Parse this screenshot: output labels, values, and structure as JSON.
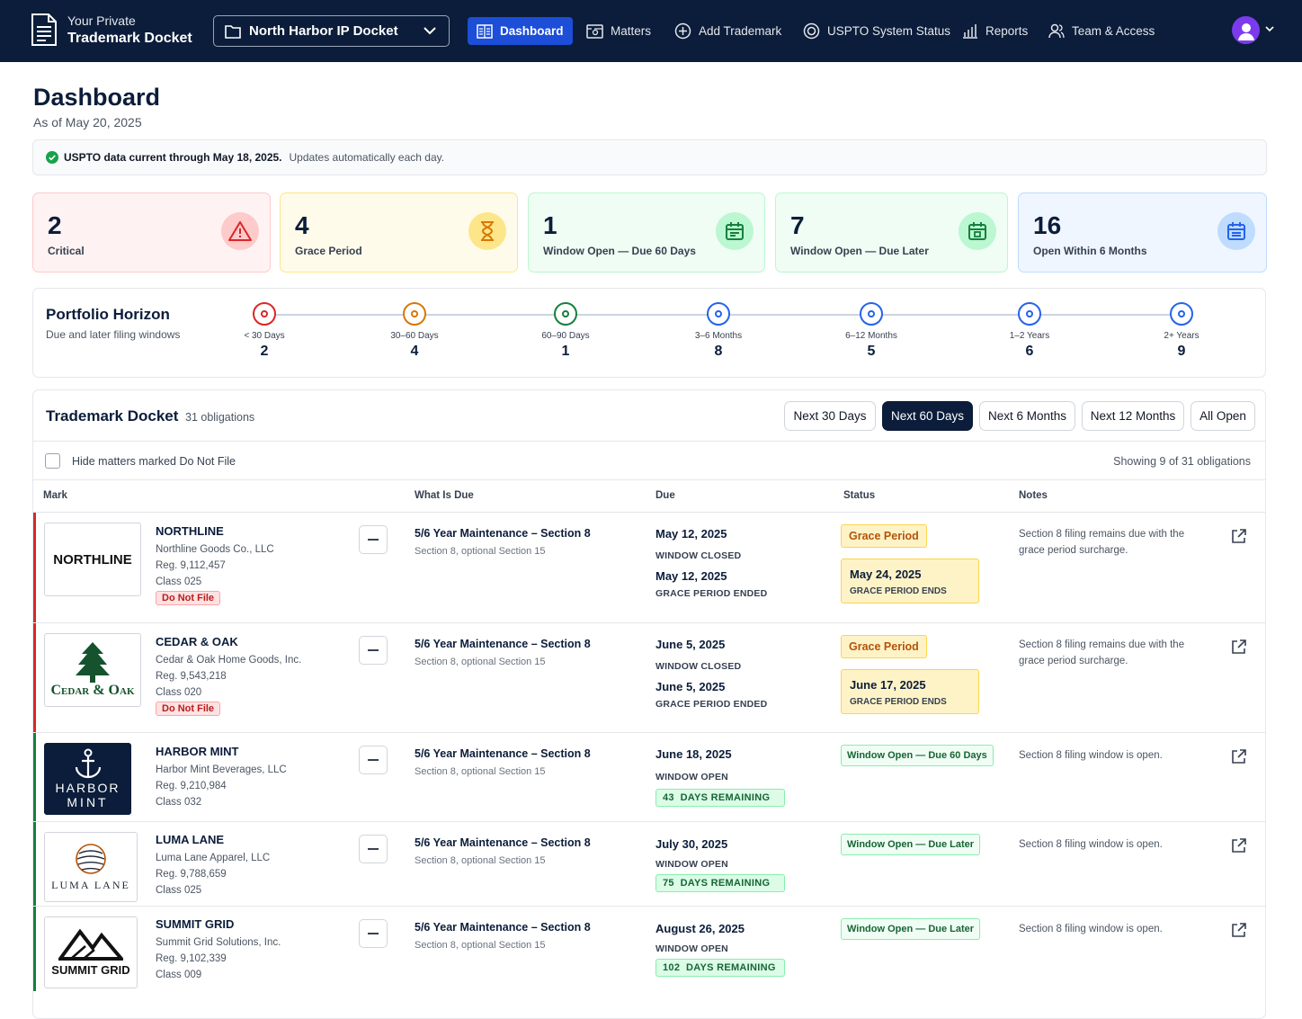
{
  "header": {
    "brand_line1": "Your Private",
    "brand_line2": "Trademark Docket",
    "docket": "North Harbor IP Docket",
    "nav": [
      {
        "label": "Dashboard",
        "icon": "dashboard-icon",
        "active": true
      },
      {
        "label": "Matters",
        "icon": "matters-icon"
      },
      {
        "label": "Add Trademark",
        "icon": "plus-circle-icon"
      },
      {
        "label": "USPTO System Status",
        "icon": "status-icon"
      },
      {
        "label": "Reports",
        "icon": "bar-chart-icon"
      },
      {
        "label": "Team & Access",
        "icon": "users-icon"
      }
    ]
  },
  "page": {
    "title": "Dashboard",
    "as_of": "As of May 20, 2025",
    "notice_bold": "USPTO data current through May 18, 2025.",
    "notice_text": "Updates automatically each day."
  },
  "cards": [
    {
      "value": "2",
      "label": "Critical",
      "icon": "alert-triangle-icon",
      "color": "#dc2626"
    },
    {
      "value": "4",
      "label": "Grace Period",
      "icon": "hourglass-icon",
      "color": "#d97706"
    },
    {
      "value": "1",
      "label": "Window Open — Due 60 Days",
      "icon": "calendar-icon",
      "color": "#15803d"
    },
    {
      "value": "7",
      "label": "Window Open — Due Later",
      "icon": "calendar-icon",
      "color": "#15803d"
    },
    {
      "value": "16",
      "label": "Open Within 6 Months",
      "icon": "calendar-icon",
      "color": "#2563eb"
    }
  ],
  "horizon": {
    "title": "Portfolio Horizon",
    "subtitle": "Due and later filing windows",
    "stops": [
      {
        "label": "< 30 Days",
        "count": "2",
        "color": "#dc2626"
      },
      {
        "label": "30–60 Days",
        "count": "4",
        "color": "#d97706"
      },
      {
        "label": "60–90 Days",
        "count": "1",
        "color": "#15803d"
      },
      {
        "label": "3–6 Months",
        "count": "8",
        "color": "#2563eb"
      },
      {
        "label": "6–12 Months",
        "count": "5",
        "color": "#2563eb"
      },
      {
        "label": "1–2 Years",
        "count": "6",
        "color": "#2563eb"
      },
      {
        "label": "2+ Years",
        "count": "9",
        "color": "#2563eb"
      }
    ]
  },
  "docket": {
    "title": "Trademark Docket",
    "count": "31 obligations",
    "ranges": [
      "Next 30 Days",
      "Next 60 Days",
      "Next 6 Months",
      "Next 12 Months",
      "All Open"
    ],
    "selected_range": "Next 60 Days",
    "hide_label": "Hide matters marked Do Not File",
    "showing": "Showing 9 of 31 obligations",
    "columns": [
      "Mark",
      "What Is Due",
      "Due",
      "Status",
      "Notes"
    ],
    "rows": [
      {
        "mark": "NORTHLINE",
        "logo_text": "NORTHLINE",
        "owner": "Northline Goods Co., LLC",
        "reg": "Reg. 9,112,457",
        "class": "Class 025",
        "dnf": "Do Not File",
        "due_what": "5/6 Year Maintenance – Section 8",
        "due_sub": "Section 8, optional Section 15",
        "date1": "May 12, 2025",
        "label1": "WINDOW CLOSED",
        "date2": "May 12, 2025",
        "label2": "GRACE PERIOD ENDED",
        "status": "Grace Period",
        "grace_date": "May 24, 2025",
        "grace_label": "GRACE PERIOD ENDS",
        "note": "Section 8 filing remains due with the grace period surcharge.",
        "accent": "#dc2626"
      },
      {
        "mark": "CEDAR & OAK",
        "logo_text": "Cedar & Oak",
        "owner": "Cedar & Oak Home Goods, Inc.",
        "reg": "Reg. 9,543,218",
        "class": "Class 020",
        "dnf": "Do Not File",
        "due_what": "5/6 Year Maintenance – Section 8",
        "due_sub": "Section 8, optional Section 15",
        "date1": "June 5, 2025",
        "label1": "WINDOW CLOSED",
        "date2": "June 5, 2025",
        "label2": "GRACE PERIOD ENDED",
        "status": "Grace Period",
        "grace_date": "June 17, 2025",
        "grace_label": "GRACE PERIOD ENDS",
        "note": "Section 8 filing remains due with the grace period surcharge.",
        "accent": "#dc2626"
      },
      {
        "mark": "HARBOR MINT",
        "logo_line1": "HARBOR",
        "logo_line2": "MINT",
        "owner": "Harbor Mint Beverages, LLC",
        "reg": "Reg. 9,210,984",
        "class": "Class 032",
        "due_what": "5/6 Year Maintenance – Section 8",
        "due_sub": "Section 8, optional Section 15",
        "date1": "June 18, 2025",
        "label1": "WINDOW OPEN",
        "days_num": "43",
        "days_label": "DAYS REMAINING",
        "status": "Window Open — Due 60 Days",
        "note": "Section 8 filing window is open.",
        "accent": "#15803d"
      },
      {
        "mark": "LUMA LANE",
        "logo_text": "LUMA LANE",
        "owner": "Luma Lane Apparel, LLC",
        "reg": "Reg. 9,788,659",
        "class": "Class 025",
        "due_what": "5/6 Year Maintenance – Section 8",
        "due_sub": "Section 8, optional Section 15",
        "date1": "July 30, 2025",
        "label1": "WINDOW OPEN",
        "days_num": "75",
        "days_label": "DAYS REMAINING",
        "status": "Window Open — Due Later",
        "note": "Section 8 filing window is open.",
        "accent": "#15803d"
      },
      {
        "mark": "SUMMIT GRID",
        "logo_text": "SUMMIT GRID",
        "owner": "Summit Grid Solutions, Inc.",
        "reg": "Reg. 9,102,339",
        "class": "Class 009",
        "due_what": "5/6 Year Maintenance – Section 8",
        "due_sub": "Section 8, optional Section 15",
        "date1": "August 26, 2025",
        "label1": "WINDOW OPEN",
        "days_num": "102",
        "days_label": "DAYS REMAINING",
        "status": "Window Open — Due Later",
        "note": "Section 8 filing window is open.",
        "accent": "#15803d"
      }
    ]
  }
}
